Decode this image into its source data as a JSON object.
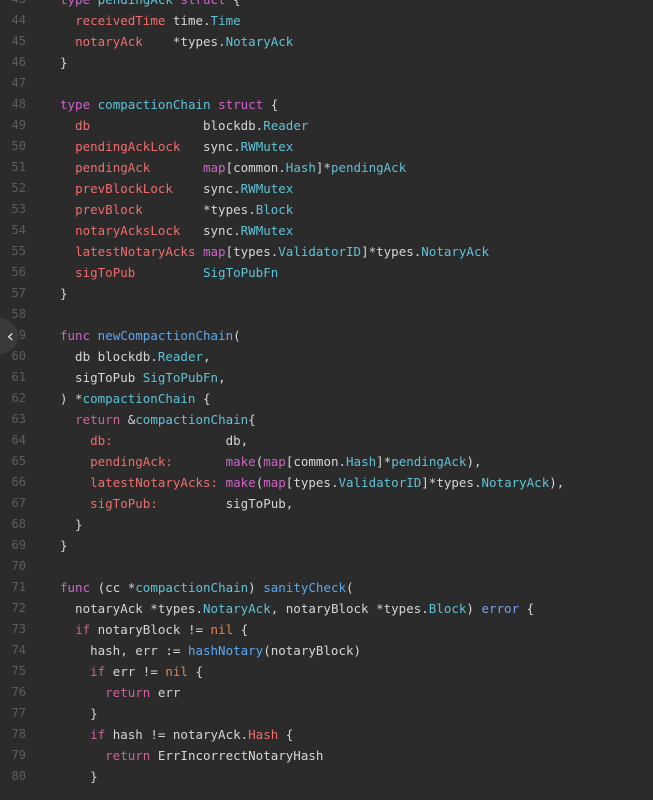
{
  "lines": [
    {
      "n": "43",
      "t": [
        [
          "kw",
          "type "
        ],
        [
          "type",
          "pendingAck "
        ],
        [
          "kw",
          "struct"
        ],
        [
          "plain",
          " {"
        ]
      ]
    },
    {
      "n": "44",
      "t": [
        [
          "plain",
          "  "
        ],
        [
          "field",
          "receivedTime "
        ],
        [
          "plain",
          "time."
        ],
        [
          "type",
          "Time"
        ]
      ]
    },
    {
      "n": "45",
      "t": [
        [
          "plain",
          "  "
        ],
        [
          "field",
          "notaryAck    "
        ],
        [
          "plain",
          "*types."
        ],
        [
          "type",
          "NotaryAck"
        ]
      ]
    },
    {
      "n": "46",
      "t": [
        [
          "plain",
          "}"
        ]
      ]
    },
    {
      "n": "47",
      "t": []
    },
    {
      "n": "48",
      "t": [
        [
          "kw",
          "type "
        ],
        [
          "type",
          "compactionChain "
        ],
        [
          "kw",
          "struct"
        ],
        [
          "plain",
          " {"
        ]
      ]
    },
    {
      "n": "49",
      "t": [
        [
          "plain",
          "  "
        ],
        [
          "field",
          "db               "
        ],
        [
          "plain",
          "blockdb."
        ],
        [
          "type",
          "Reader"
        ]
      ]
    },
    {
      "n": "50",
      "t": [
        [
          "plain",
          "  "
        ],
        [
          "field",
          "pendingAckLock   "
        ],
        [
          "plain",
          "sync."
        ],
        [
          "type",
          "RWMutex"
        ]
      ]
    },
    {
      "n": "51",
      "t": [
        [
          "plain",
          "  "
        ],
        [
          "field",
          "pendingAck       "
        ],
        [
          "kw",
          "map"
        ],
        [
          "plain",
          "[common."
        ],
        [
          "type",
          "Hash"
        ],
        [
          "plain",
          "]*"
        ],
        [
          "type",
          "pendingAck"
        ]
      ]
    },
    {
      "n": "52",
      "t": [
        [
          "plain",
          "  "
        ],
        [
          "field",
          "prevBlockLock    "
        ],
        [
          "plain",
          "sync."
        ],
        [
          "type",
          "RWMutex"
        ]
      ]
    },
    {
      "n": "53",
      "t": [
        [
          "plain",
          "  "
        ],
        [
          "field",
          "prevBlock        "
        ],
        [
          "plain",
          "*types."
        ],
        [
          "type",
          "Block"
        ]
      ]
    },
    {
      "n": "54",
      "t": [
        [
          "plain",
          "  "
        ],
        [
          "field",
          "notaryAcksLock   "
        ],
        [
          "plain",
          "sync."
        ],
        [
          "type",
          "RWMutex"
        ]
      ]
    },
    {
      "n": "55",
      "t": [
        [
          "plain",
          "  "
        ],
        [
          "field",
          "latestNotaryAcks "
        ],
        [
          "kw",
          "map"
        ],
        [
          "plain",
          "[types."
        ],
        [
          "type",
          "ValidatorID"
        ],
        [
          "plain",
          "]*types."
        ],
        [
          "type",
          "NotaryAck"
        ]
      ]
    },
    {
      "n": "56",
      "t": [
        [
          "plain",
          "  "
        ],
        [
          "field",
          "sigToPub         "
        ],
        [
          "type",
          "SigToPubFn"
        ]
      ]
    },
    {
      "n": "57",
      "t": [
        [
          "plain",
          "}"
        ]
      ]
    },
    {
      "n": "58",
      "t": []
    },
    {
      "n": "59",
      "t": [
        [
          "kw",
          "func "
        ],
        [
          "fn",
          "newCompactionChain"
        ],
        [
          "plain",
          "("
        ]
      ]
    },
    {
      "n": "60",
      "t": [
        [
          "plain",
          "  db blockdb."
        ],
        [
          "type",
          "Reader"
        ],
        [
          "plain",
          ","
        ]
      ]
    },
    {
      "n": "61",
      "t": [
        [
          "plain",
          "  sigToPub "
        ],
        [
          "type",
          "SigToPubFn"
        ],
        [
          "plain",
          ","
        ]
      ]
    },
    {
      "n": "62",
      "t": [
        [
          "plain",
          ") *"
        ],
        [
          "type",
          "compactionChain"
        ],
        [
          "plain",
          " {"
        ]
      ]
    },
    {
      "n": "63",
      "t": [
        [
          "plain",
          "  "
        ],
        [
          "kw2",
          "return "
        ],
        [
          "plain",
          "&"
        ],
        [
          "type",
          "compactionChain"
        ],
        [
          "plain",
          "{"
        ]
      ]
    },
    {
      "n": "64",
      "t": [
        [
          "plain",
          "    "
        ],
        [
          "field",
          "db:"
        ],
        [
          "plain",
          "               db,"
        ]
      ]
    },
    {
      "n": "65",
      "t": [
        [
          "plain",
          "    "
        ],
        [
          "field",
          "pendingAck:"
        ],
        [
          "plain",
          "       "
        ],
        [
          "kw",
          "make"
        ],
        [
          "plain",
          "("
        ],
        [
          "kw",
          "map"
        ],
        [
          "plain",
          "[common."
        ],
        [
          "type",
          "Hash"
        ],
        [
          "plain",
          "]*"
        ],
        [
          "type",
          "pendingAck"
        ],
        [
          "plain",
          "),"
        ]
      ]
    },
    {
      "n": "66",
      "t": [
        [
          "plain",
          "    "
        ],
        [
          "field",
          "latestNotaryAcks:"
        ],
        [
          "plain",
          " "
        ],
        [
          "kw",
          "make"
        ],
        [
          "plain",
          "("
        ],
        [
          "kw",
          "map"
        ],
        [
          "plain",
          "[types."
        ],
        [
          "type",
          "ValidatorID"
        ],
        [
          "plain",
          "]*types."
        ],
        [
          "type",
          "NotaryAck"
        ],
        [
          "plain",
          "),"
        ]
      ]
    },
    {
      "n": "67",
      "t": [
        [
          "plain",
          "    "
        ],
        [
          "field",
          "sigToPub:"
        ],
        [
          "plain",
          "         sigToPub,"
        ]
      ]
    },
    {
      "n": "68",
      "t": [
        [
          "plain",
          "  }"
        ]
      ]
    },
    {
      "n": "69",
      "t": [
        [
          "plain",
          "}"
        ]
      ]
    },
    {
      "n": "70",
      "t": []
    },
    {
      "n": "71",
      "t": [
        [
          "kw",
          "func "
        ],
        [
          "plain",
          "(cc *"
        ],
        [
          "type",
          "compactionChain"
        ],
        [
          "plain",
          ") "
        ],
        [
          "fn",
          "sanityCheck"
        ],
        [
          "plain",
          "("
        ]
      ]
    },
    {
      "n": "72",
      "t": [
        [
          "plain",
          "  notaryAck *types."
        ],
        [
          "type",
          "NotaryAck"
        ],
        [
          "plain",
          ", notaryBlock *types."
        ],
        [
          "type",
          "Block"
        ],
        [
          "plain",
          ") "
        ],
        [
          "kwblue",
          "error"
        ],
        [
          "plain",
          " {"
        ]
      ]
    },
    {
      "n": "73",
      "t": [
        [
          "plain",
          "  "
        ],
        [
          "kw2",
          "if "
        ],
        [
          "plain",
          "notaryBlock != "
        ],
        [
          "nil",
          "nil"
        ],
        [
          "plain",
          " {"
        ]
      ]
    },
    {
      "n": "74",
      "t": [
        [
          "plain",
          "    hash, err := "
        ],
        [
          "fn",
          "hashNotary"
        ],
        [
          "plain",
          "(notaryBlock)"
        ]
      ]
    },
    {
      "n": "75",
      "t": [
        [
          "plain",
          "    "
        ],
        [
          "kw2",
          "if "
        ],
        [
          "plain",
          "err != "
        ],
        [
          "nil",
          "nil"
        ],
        [
          "plain",
          " {"
        ]
      ]
    },
    {
      "n": "76",
      "t": [
        [
          "plain",
          "      "
        ],
        [
          "kw2",
          "return "
        ],
        [
          "plain",
          "err"
        ]
      ]
    },
    {
      "n": "77",
      "t": [
        [
          "plain",
          "    }"
        ]
      ]
    },
    {
      "n": "78",
      "t": [
        [
          "plain",
          "    "
        ],
        [
          "kw2",
          "if "
        ],
        [
          "plain",
          "hash != notaryAck."
        ],
        [
          "field",
          "Hash"
        ],
        [
          "plain",
          " {"
        ]
      ]
    },
    {
      "n": "79",
      "t": [
        [
          "plain",
          "      "
        ],
        [
          "kw2",
          "return "
        ],
        [
          "plain",
          "ErrIncorrectNotaryHash"
        ]
      ]
    },
    {
      "n": "80",
      "t": [
        [
          "plain",
          "    }"
        ]
      ]
    }
  ],
  "nav_handle": {
    "glyph": "‹",
    "icon": "chevron-left-icon"
  }
}
